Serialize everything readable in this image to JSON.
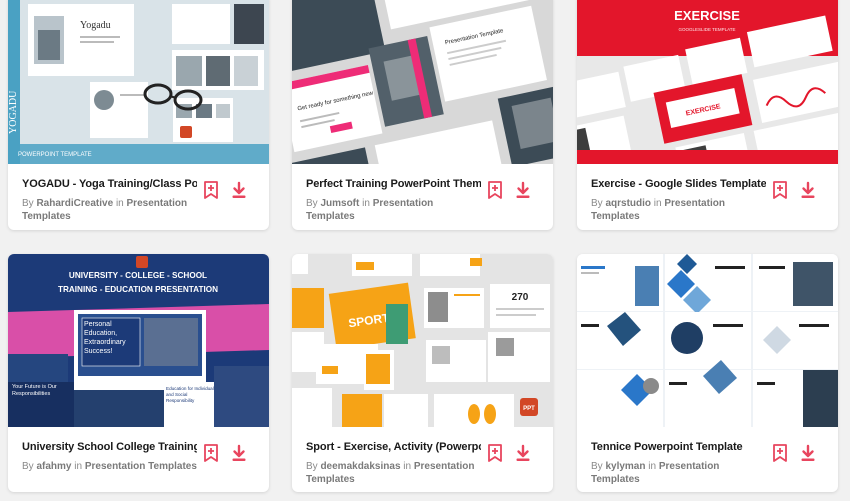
{
  "colors": {
    "accent": "#e8455e",
    "background": "#f1f1f1",
    "card": "#ffffff",
    "title_text": "#1a1a1a",
    "meta_text": "#8a8a8a"
  },
  "cards": [
    {
      "title": "YOGADU - Yoga Training/Class Po...",
      "author_prefix": "By",
      "author": "RahardiCreative",
      "category_prefix": "in",
      "category": "Presentation Templates",
      "thumb_text": {
        "brand": "Yogadu",
        "side": "YOGADU",
        "footer": "POWERPOINT TEMPLATE"
      },
      "icons": [
        "bookmark-icon",
        "download-icon"
      ]
    },
    {
      "title": "Perfect Training PowerPoint Theme",
      "author_prefix": "By",
      "author": "Jumsoft",
      "category_prefix": "in",
      "category": "Presentation Templates",
      "thumb_text": {
        "slide_a": "Get ready for something new",
        "slide_b": "Presentation Template"
      },
      "icons": [
        "bookmark-icon",
        "download-icon"
      ]
    },
    {
      "title": "Exercise - Google Slides Template",
      "author_prefix": "By",
      "author": "aqrstudio",
      "category_prefix": "in",
      "category": "Presentation Templates",
      "thumb_text": {
        "headline": "EXERCISE",
        "sub": "GOOGLESLIDE TEMPLATE",
        "center": "EXERCISE"
      },
      "icons": [
        "bookmark-icon",
        "download-icon"
      ]
    },
    {
      "title": "University School College Training ...",
      "author_prefix": "By",
      "author": "afahmy",
      "category_prefix": "in",
      "category": "Presentation Templates",
      "thumb_text": {
        "line1": "UNIVERSITY - COLLEGE - SCHOOL",
        "line2": "TRAINING - EDUCATION PRESENTATION",
        "box": "Personal Education, Extraordinary Success!",
        "left": "Your Future is Our Responsibilities",
        "right": "Education for Individual and Social Responsibility"
      },
      "icons": [
        "bookmark-icon",
        "download-icon"
      ]
    },
    {
      "title": "Sport - Exercise, Activity (Powerpo...",
      "author_prefix": "By",
      "author": "deemakdaksinas",
      "category_prefix": "in",
      "category": "Presentation Templates",
      "thumb_text": {
        "brand": "SPORTY",
        "num": "270",
        "badge": "PPT"
      },
      "icons": [
        "bookmark-icon",
        "download-icon"
      ]
    },
    {
      "title": "Tennice Powerpoint Template",
      "author_prefix": "By",
      "author": "kylyman",
      "category_prefix": "in",
      "category": "Presentation Templates",
      "thumb_text": {},
      "icons": [
        "bookmark-icon",
        "download-icon"
      ]
    }
  ]
}
